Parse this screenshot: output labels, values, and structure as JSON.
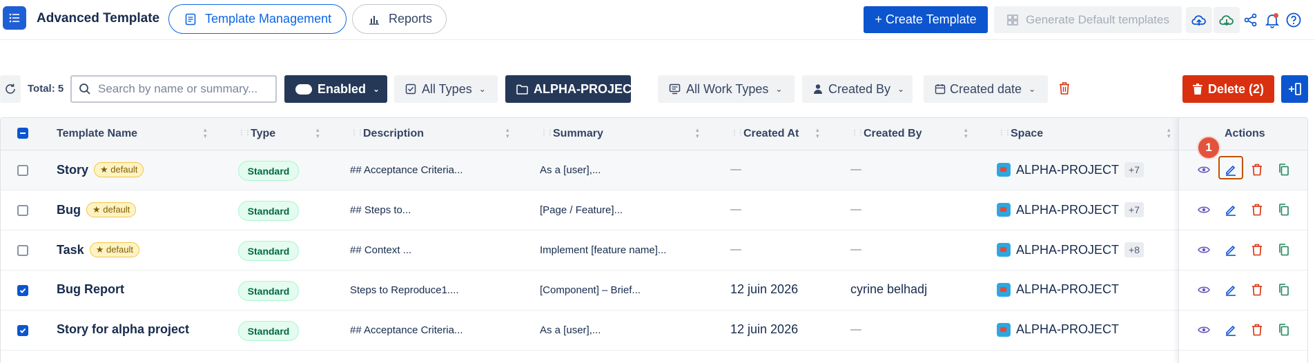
{
  "header": {
    "app_title": "Advanced Template",
    "tabs": [
      {
        "label": "Template Management",
        "active": true
      },
      {
        "label": "Reports",
        "active": false
      }
    ],
    "create_button": "+ Create Template",
    "generate_button": "Generate Default templates",
    "icons": [
      "upload-cloud-icon",
      "download-cloud-icon",
      "share-icon",
      "bell-icon",
      "help-icon"
    ]
  },
  "filters": {
    "total": "Total: 5",
    "search_placeholder": "Search by name or summary...",
    "status": "Enabled",
    "types": "All Types",
    "project": "ALPHA-PROJECT",
    "work_types": "All Work Types",
    "created_by": "Created By",
    "created_date": "Created date",
    "delete_button": "Delete (2)"
  },
  "table": {
    "columns": {
      "name": "Template Name",
      "type": "Type",
      "description": "Description",
      "summary": "Summary",
      "created_at": "Created At",
      "created_by": "Created By",
      "space": "Space",
      "actions": "Actions"
    },
    "default_badge": "★ default",
    "rows": [
      {
        "name": "Story",
        "default": true,
        "checked": false,
        "type": "Standard",
        "description": "## Acceptance Criteria...",
        "summary": "As a [user],...",
        "created_at": "—",
        "created_by": "—",
        "space": "ALPHA-PROJECT",
        "more": "+7"
      },
      {
        "name": "Bug",
        "default": true,
        "checked": false,
        "type": "Standard",
        "description": "## Steps to...",
        "summary": "[Page / Feature]...",
        "created_at": "—",
        "created_by": "—",
        "space": "ALPHA-PROJECT",
        "more": "+7"
      },
      {
        "name": "Task",
        "default": true,
        "checked": false,
        "type": "Standard",
        "description": "## Context ...",
        "summary": "Implement [feature name]...",
        "created_at": "—",
        "created_by": "—",
        "space": "ALPHA-PROJECT",
        "more": "+8"
      },
      {
        "name": "Bug Report",
        "default": false,
        "checked": true,
        "type": "Standard",
        "description": "Steps to Reproduce1....",
        "summary": "[Component] – Brief...",
        "created_at": "12 juin 2026",
        "created_by": "cyrine belhadj",
        "space": "ALPHA-PROJECT",
        "more": ""
      },
      {
        "name": "Story for alpha project",
        "default": false,
        "checked": true,
        "type": "Standard",
        "description": "## Acceptance Criteria...",
        "summary": "As a [user],...",
        "created_at": "12 juin 2026",
        "created_by": "—",
        "space": "ALPHA-PROJECT",
        "more": ""
      }
    ]
  },
  "annotation": {
    "marker": "1"
  },
  "colors": {
    "primary": "#0c55cf",
    "danger": "#d9300f",
    "dark": "#253858",
    "success_bg": "#e3fcef"
  }
}
